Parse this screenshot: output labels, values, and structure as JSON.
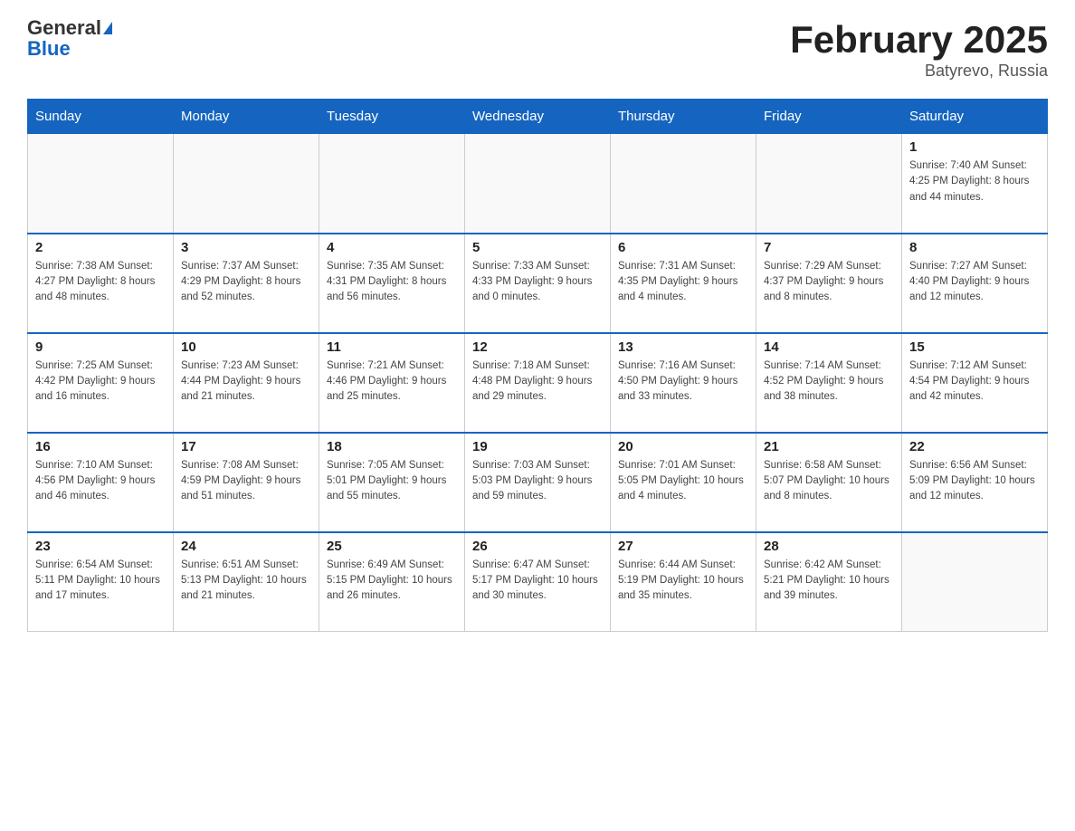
{
  "header": {
    "logo_general": "General",
    "logo_blue": "Blue",
    "title": "February 2025",
    "location": "Batyrevo, Russia"
  },
  "days_of_week": [
    "Sunday",
    "Monday",
    "Tuesday",
    "Wednesday",
    "Thursday",
    "Friday",
    "Saturday"
  ],
  "weeks": [
    [
      {
        "day": "",
        "info": ""
      },
      {
        "day": "",
        "info": ""
      },
      {
        "day": "",
        "info": ""
      },
      {
        "day": "",
        "info": ""
      },
      {
        "day": "",
        "info": ""
      },
      {
        "day": "",
        "info": ""
      },
      {
        "day": "1",
        "info": "Sunrise: 7:40 AM\nSunset: 4:25 PM\nDaylight: 8 hours\nand 44 minutes."
      }
    ],
    [
      {
        "day": "2",
        "info": "Sunrise: 7:38 AM\nSunset: 4:27 PM\nDaylight: 8 hours\nand 48 minutes."
      },
      {
        "day": "3",
        "info": "Sunrise: 7:37 AM\nSunset: 4:29 PM\nDaylight: 8 hours\nand 52 minutes."
      },
      {
        "day": "4",
        "info": "Sunrise: 7:35 AM\nSunset: 4:31 PM\nDaylight: 8 hours\nand 56 minutes."
      },
      {
        "day": "5",
        "info": "Sunrise: 7:33 AM\nSunset: 4:33 PM\nDaylight: 9 hours\nand 0 minutes."
      },
      {
        "day": "6",
        "info": "Sunrise: 7:31 AM\nSunset: 4:35 PM\nDaylight: 9 hours\nand 4 minutes."
      },
      {
        "day": "7",
        "info": "Sunrise: 7:29 AM\nSunset: 4:37 PM\nDaylight: 9 hours\nand 8 minutes."
      },
      {
        "day": "8",
        "info": "Sunrise: 7:27 AM\nSunset: 4:40 PM\nDaylight: 9 hours\nand 12 minutes."
      }
    ],
    [
      {
        "day": "9",
        "info": "Sunrise: 7:25 AM\nSunset: 4:42 PM\nDaylight: 9 hours\nand 16 minutes."
      },
      {
        "day": "10",
        "info": "Sunrise: 7:23 AM\nSunset: 4:44 PM\nDaylight: 9 hours\nand 21 minutes."
      },
      {
        "day": "11",
        "info": "Sunrise: 7:21 AM\nSunset: 4:46 PM\nDaylight: 9 hours\nand 25 minutes."
      },
      {
        "day": "12",
        "info": "Sunrise: 7:18 AM\nSunset: 4:48 PM\nDaylight: 9 hours\nand 29 minutes."
      },
      {
        "day": "13",
        "info": "Sunrise: 7:16 AM\nSunset: 4:50 PM\nDaylight: 9 hours\nand 33 minutes."
      },
      {
        "day": "14",
        "info": "Sunrise: 7:14 AM\nSunset: 4:52 PM\nDaylight: 9 hours\nand 38 minutes."
      },
      {
        "day": "15",
        "info": "Sunrise: 7:12 AM\nSunset: 4:54 PM\nDaylight: 9 hours\nand 42 minutes."
      }
    ],
    [
      {
        "day": "16",
        "info": "Sunrise: 7:10 AM\nSunset: 4:56 PM\nDaylight: 9 hours\nand 46 minutes."
      },
      {
        "day": "17",
        "info": "Sunrise: 7:08 AM\nSunset: 4:59 PM\nDaylight: 9 hours\nand 51 minutes."
      },
      {
        "day": "18",
        "info": "Sunrise: 7:05 AM\nSunset: 5:01 PM\nDaylight: 9 hours\nand 55 minutes."
      },
      {
        "day": "19",
        "info": "Sunrise: 7:03 AM\nSunset: 5:03 PM\nDaylight: 9 hours\nand 59 minutes."
      },
      {
        "day": "20",
        "info": "Sunrise: 7:01 AM\nSunset: 5:05 PM\nDaylight: 10 hours\nand 4 minutes."
      },
      {
        "day": "21",
        "info": "Sunrise: 6:58 AM\nSunset: 5:07 PM\nDaylight: 10 hours\nand 8 minutes."
      },
      {
        "day": "22",
        "info": "Sunrise: 6:56 AM\nSunset: 5:09 PM\nDaylight: 10 hours\nand 12 minutes."
      }
    ],
    [
      {
        "day": "23",
        "info": "Sunrise: 6:54 AM\nSunset: 5:11 PM\nDaylight: 10 hours\nand 17 minutes."
      },
      {
        "day": "24",
        "info": "Sunrise: 6:51 AM\nSunset: 5:13 PM\nDaylight: 10 hours\nand 21 minutes."
      },
      {
        "day": "25",
        "info": "Sunrise: 6:49 AM\nSunset: 5:15 PM\nDaylight: 10 hours\nand 26 minutes."
      },
      {
        "day": "26",
        "info": "Sunrise: 6:47 AM\nSunset: 5:17 PM\nDaylight: 10 hours\nand 30 minutes."
      },
      {
        "day": "27",
        "info": "Sunrise: 6:44 AM\nSunset: 5:19 PM\nDaylight: 10 hours\nand 35 minutes."
      },
      {
        "day": "28",
        "info": "Sunrise: 6:42 AM\nSunset: 5:21 PM\nDaylight: 10 hours\nand 39 minutes."
      },
      {
        "day": "",
        "info": ""
      }
    ]
  ]
}
